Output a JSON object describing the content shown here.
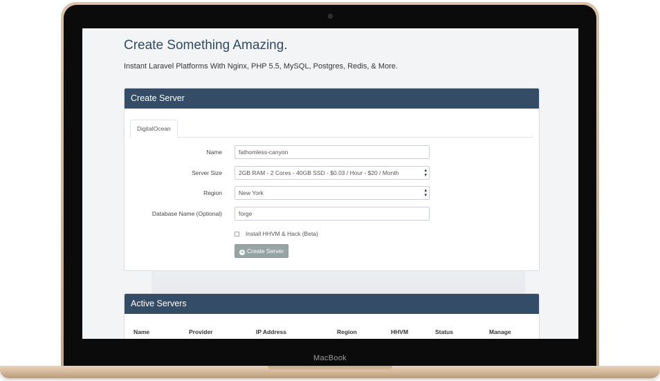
{
  "device": {
    "brand": "MacBook"
  },
  "page": {
    "title": "Create Something Amazing.",
    "subtitle": "Instant Laravel Platforms With Nginx, PHP 5.5, MySQL, Postgres, Redis, & More."
  },
  "create_server": {
    "heading": "Create Server",
    "tabs": [
      {
        "label": "DigitalOcean",
        "active": true
      }
    ],
    "fields": {
      "name": {
        "label": "Name",
        "value": "fathomless-canyon"
      },
      "server_size": {
        "label": "Server Size",
        "value": "2GB RAM - 2 Cores - 40GB SSD - $0.03 / Hour - $20 / Month"
      },
      "region": {
        "label": "Region",
        "value": "New York"
      },
      "database_name": {
        "label": "Database Name (Optional)",
        "value": "forge"
      }
    },
    "hhvm_checkbox": {
      "label": "Install HHVM & Hack (Beta)",
      "checked": false
    },
    "submit_label": "Create Server",
    "submit_icon": "plus-circle-icon"
  },
  "active_servers": {
    "heading": "Active Servers",
    "columns": [
      "Name",
      "Provider",
      "IP Address",
      "Region",
      "HHVM",
      "Status",
      "Manage"
    ]
  },
  "colors": {
    "panel_heading": "#344c65",
    "title": "#2f4964",
    "button": "#96a4a4",
    "laptop_gold": "#d7bc9d"
  }
}
